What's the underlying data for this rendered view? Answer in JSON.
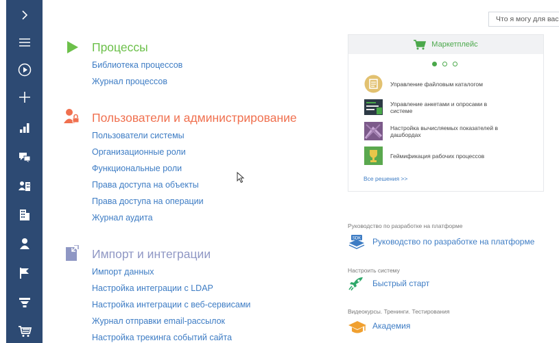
{
  "search": {
    "placeholder": "Что я могу для вас сделать?"
  },
  "sidebar": {
    "items": [
      {
        "icon": "chevron-right-icon"
      },
      {
        "icon": "menu-icon"
      },
      {
        "icon": "play-icon"
      },
      {
        "icon": "plus-icon"
      },
      {
        "icon": "bar-chart-icon"
      },
      {
        "icon": "chat-icon"
      },
      {
        "icon": "contacts-building-icon"
      },
      {
        "icon": "building-icon"
      },
      {
        "icon": "person-icon"
      },
      {
        "icon": "flag-icon"
      },
      {
        "icon": "funnel-icon"
      },
      {
        "icon": "cart-icon"
      }
    ]
  },
  "sections": {
    "processes": {
      "title": "Процессы",
      "links": [
        "Библиотека процессов",
        "Журнал процессов"
      ]
    },
    "users": {
      "title": "Пользователи и администрирование",
      "links": [
        "Пользователи системы",
        "Организационные роли",
        "Функциональные роли",
        "Права доступа на объекты",
        "Права доступа на операции",
        "Журнал аудита"
      ]
    },
    "import": {
      "title": "Импорт и интеграции",
      "links": [
        "Импорт данных",
        "Настройка интеграции с LDAP",
        "Настройка интеграции с веб-сервисами",
        "Журнал отправки email-рассылок",
        "Настройка трекинга событий сайта"
      ]
    }
  },
  "marketplace": {
    "title": "Маркетплейс",
    "items": [
      "Управление файловым каталогом",
      "Управление анкетами и опросами в системе",
      "Настройка вычисляемых показателей в дашбордах",
      "Геймификация рабочих процессов"
    ],
    "all_solutions": "Все решения >>"
  },
  "help": [
    {
      "caption": "Руководство по разработке на платформе",
      "link": "Руководство по разработке на платформе"
    },
    {
      "caption": "Настроить систему",
      "link": "Быстрый старт"
    },
    {
      "caption": "Видеокурсы. Тренинги. Тестирования",
      "link": "Академия"
    }
  ],
  "colors": {
    "sidebar": "#2d4a73",
    "processes": "#6cc04a",
    "users": "#f0704f",
    "import": "#8f97c4",
    "link": "#3d7cc4"
  }
}
